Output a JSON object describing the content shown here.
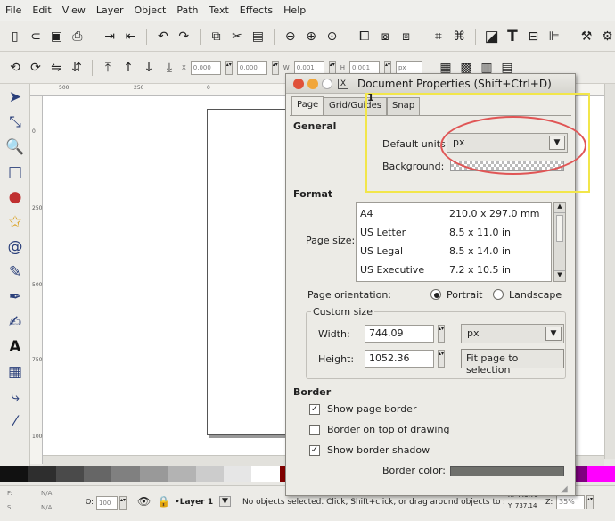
{
  "menu": [
    "File",
    "Edit",
    "View",
    "Layer",
    "Object",
    "Path",
    "Text",
    "Effects",
    "Help"
  ],
  "toolbar_controls": {
    "x_label": "X",
    "x_value": "0.000",
    "y_value": "0.000",
    "w_label": "W",
    "w_value": "0.001",
    "h_label": "H",
    "h_value": "0.001",
    "unit": "px"
  },
  "rulers": {
    "h": [
      "500",
      "250",
      "0"
    ],
    "v": [
      "0",
      "250",
      "500",
      "750",
      "1000"
    ]
  },
  "dialog": {
    "title": "Document Properties (Shift+Ctrl+D)",
    "tabs": [
      "Page",
      "Grid/Guides",
      "Snap"
    ],
    "general_heading": "General",
    "default_units_label": "Default units:",
    "default_units_value": "px",
    "background_label": "Background:",
    "format_heading": "Format",
    "page_size_label": "Page size:",
    "page_sizes": [
      {
        "name": "A4",
        "size": "210.0 x 297.0 mm"
      },
      {
        "name": "US Letter",
        "size": "8.5 x 11.0 in"
      },
      {
        "name": "US Legal",
        "size": "8.5 x 14.0 in"
      },
      {
        "name": "US Executive",
        "size": "7.2 x 10.5 in"
      }
    ],
    "orientation_label": "Page orientation:",
    "portrait": "Portrait",
    "landscape": "Landscape",
    "custom_size_label": "Custom size",
    "width_label": "Width:",
    "width_value": "744.09",
    "height_label": "Height:",
    "height_value": "1052.36",
    "size_unit": "px",
    "fit_button": "Fit page to selection",
    "border_heading": "Border",
    "show_border": "Show page border",
    "border_on_top": "Border on top of drawing",
    "show_shadow": "Show border shadow",
    "border_color_label": "Border color:",
    "annotation_number": "1"
  },
  "status": {
    "fill_label": "F:",
    "fill_value": "N/A",
    "stroke_label": "S:",
    "stroke_value": "N/A",
    "opacity_label": "O:",
    "opacity_value": "100",
    "layer": "•Layer 1",
    "message": "No objects selected. Click, Shift+click, or drag around objects to select.",
    "coord_x": "X: 443.73",
    "coord_y": "Y: 737.14",
    "zoom_label": "Z:",
    "zoom": "35%"
  },
  "colors": {
    "annotation_box": "#f2e64a",
    "annotation_ellipse": "#e05555",
    "border_color": "#6f706c"
  }
}
